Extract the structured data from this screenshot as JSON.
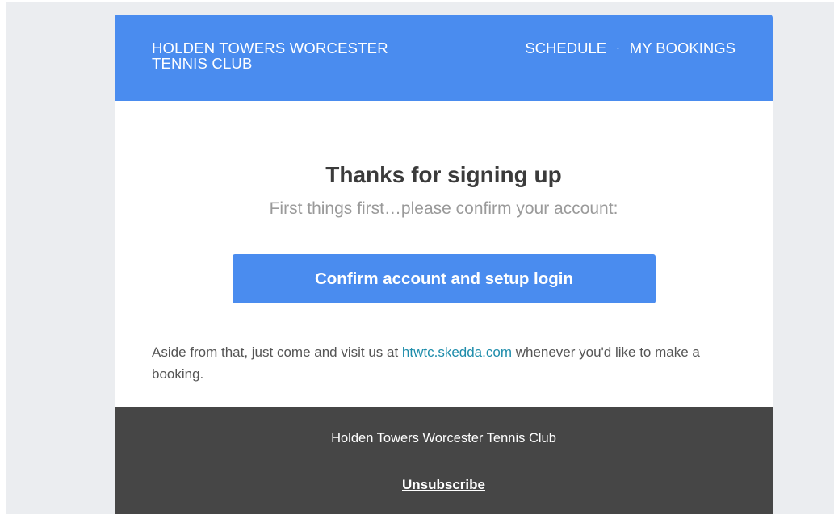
{
  "header": {
    "brand": "HOLDEN TOWERS WORCESTER TENNIS CLUB",
    "nav": {
      "schedule": "SCHEDULE",
      "separator": "·",
      "my_bookings": "MY BOOKINGS"
    }
  },
  "main": {
    "title": "Thanks for signing up",
    "subtitle": "First things first…please confirm your account:",
    "cta_label": "Confirm account and setup login",
    "aside_before": "Aside from that, just come and visit us at ",
    "aside_link": "htwtc.skedda.com",
    "aside_after": " whenever you'd like to make a booking."
  },
  "footer": {
    "club_name": "Holden Towers Worcester Tennis Club",
    "unsubscribe": "Unsubscribe"
  },
  "colors": {
    "header_bg": "#4a8cef",
    "button_bg": "#4a8cef",
    "link": "#1f8dab",
    "footer_bg": "#464646",
    "page_bg": "#ebedf0"
  }
}
